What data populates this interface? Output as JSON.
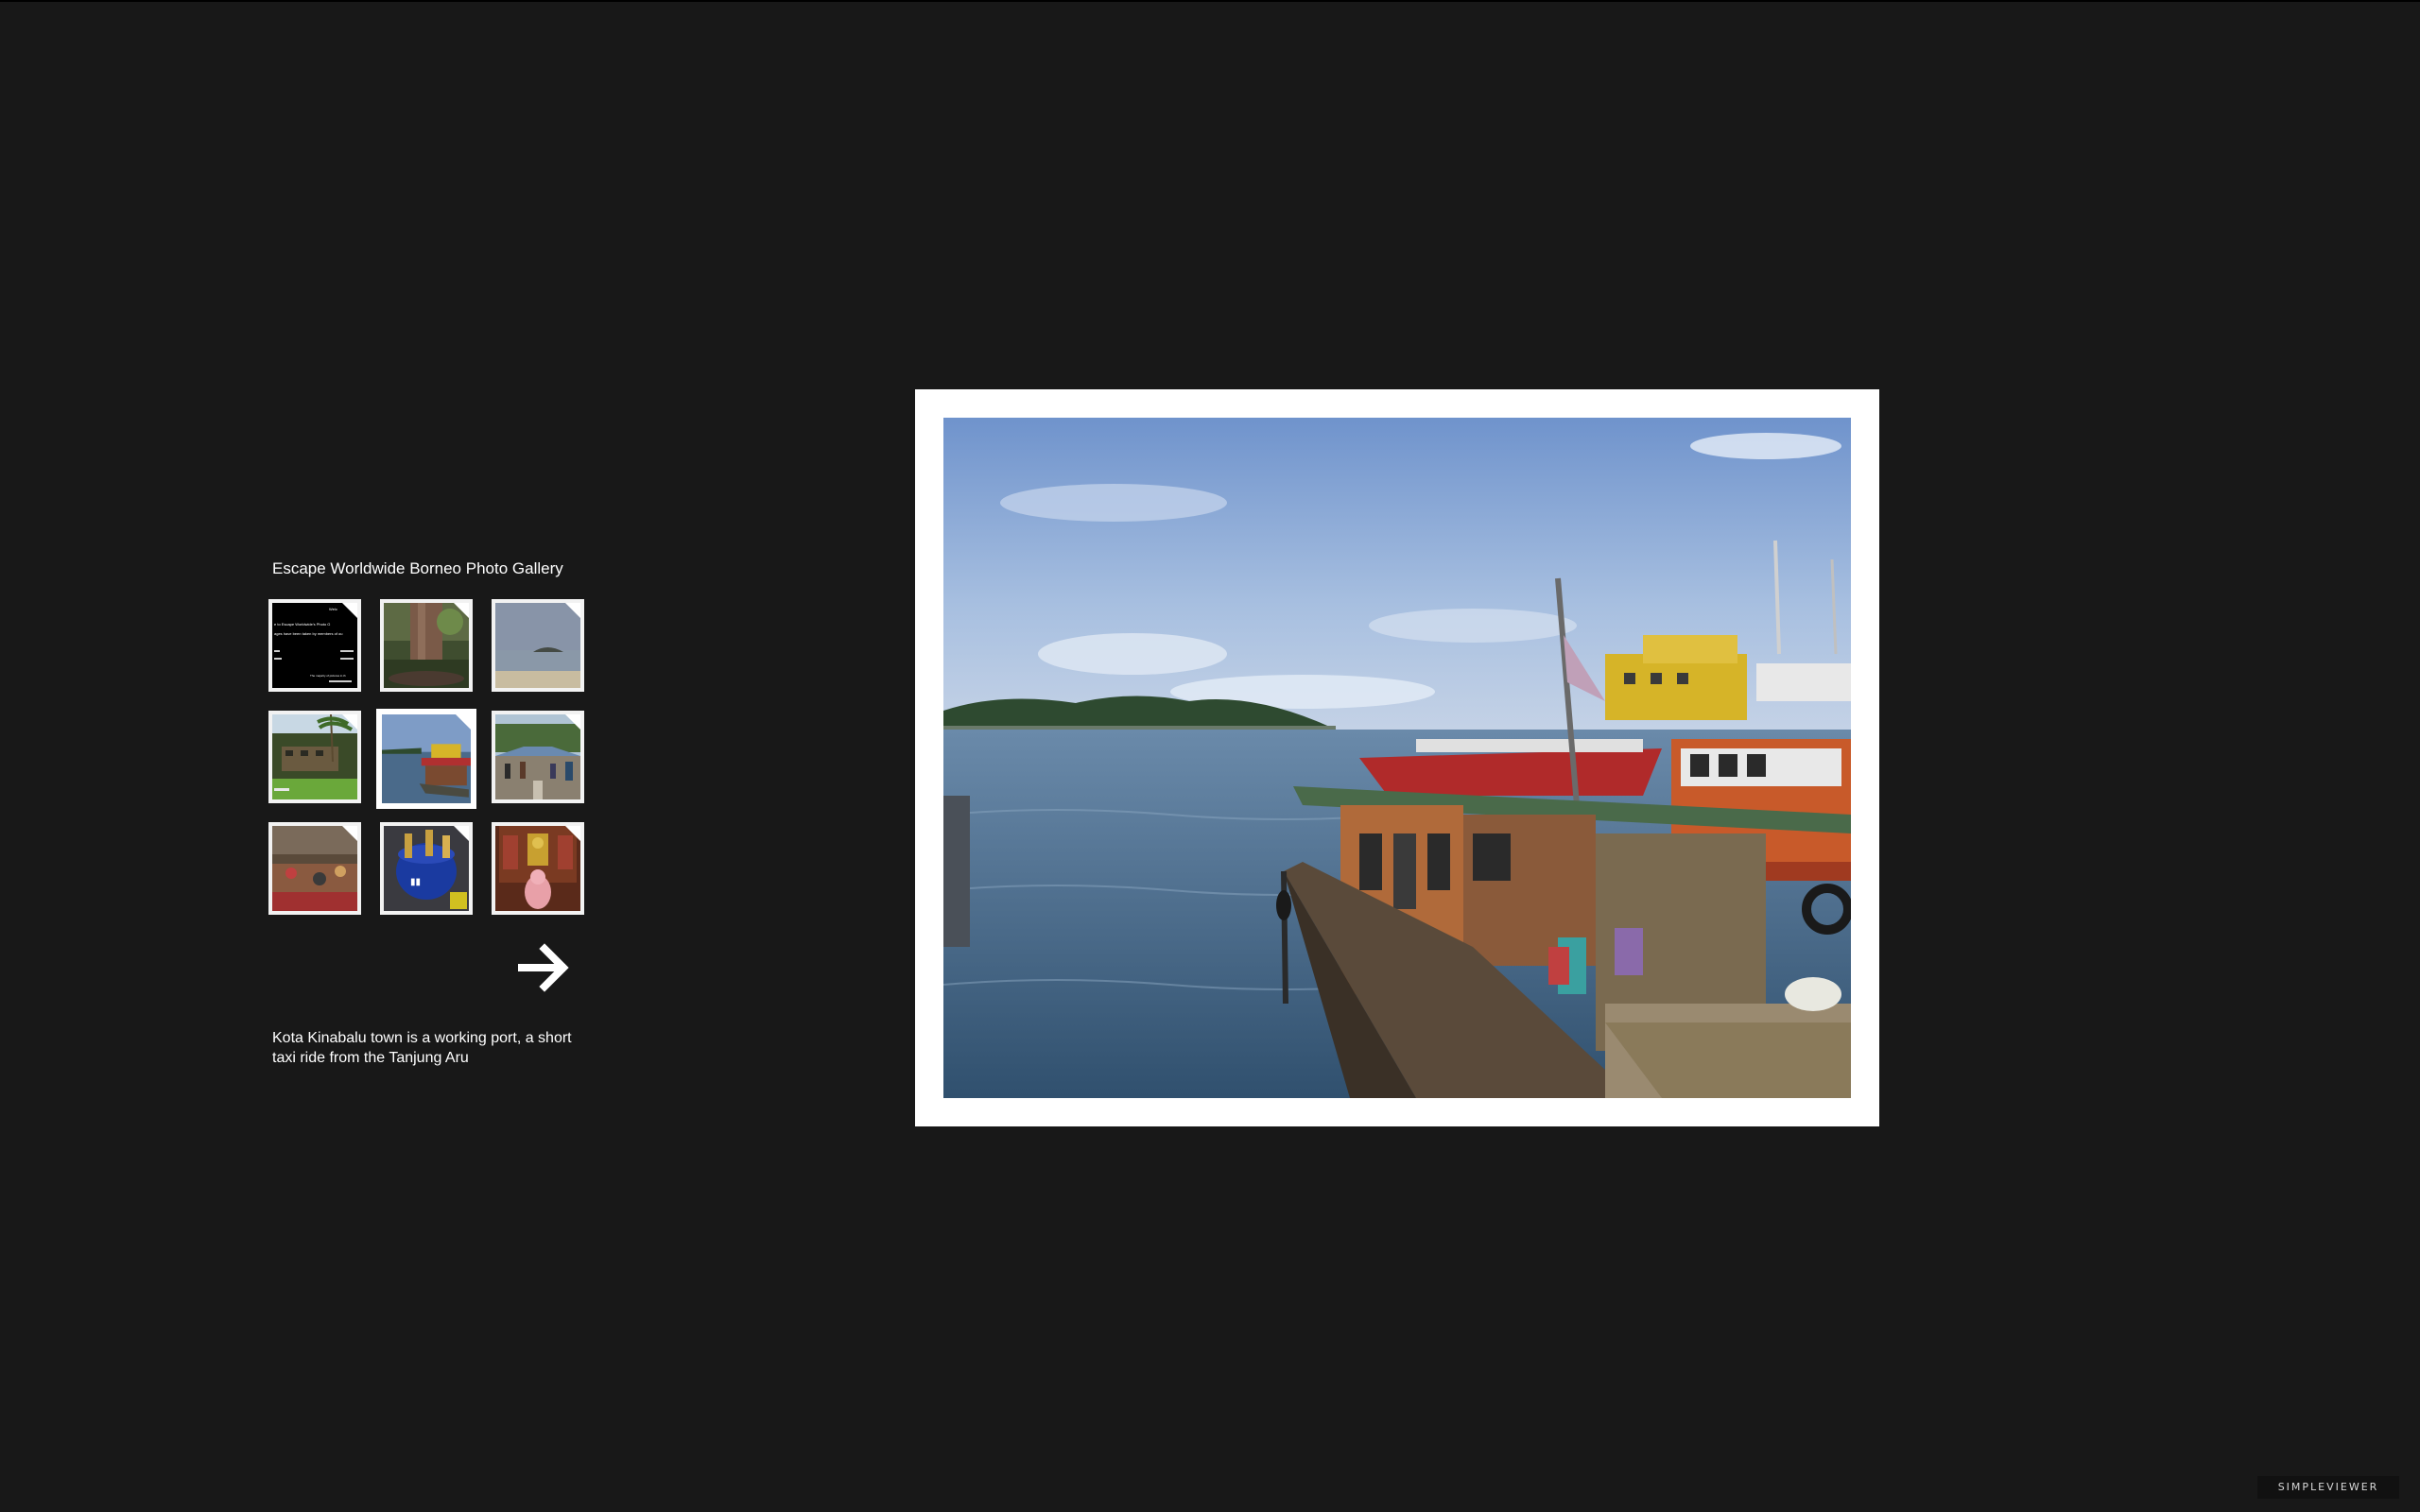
{
  "gallery": {
    "title": "Escape Worldwide Borneo Photo Gallery",
    "caption": "Kota Kinabalu town is a working port, a short taxi ride from the Tanjung Aru",
    "selected_index": 4,
    "thumbnails": [
      {
        "subject": "welcome-text-slide",
        "lines": [
          "Welc",
          "e to Escape Worldwide's Photo G",
          "ages have been taken by members of ou",
          "The majority of pictures in th"
        ]
      },
      {
        "subject": "rainforest-tree"
      },
      {
        "subject": "beach-island"
      },
      {
        "subject": "resort-palm"
      },
      {
        "subject": "harbor-boat"
      },
      {
        "subject": "market-street"
      },
      {
        "subject": "night-market"
      },
      {
        "subject": "drinks-bucket"
      },
      {
        "subject": "temple-statue"
      }
    ]
  },
  "navigation": {
    "next_icon": "arrow-right-icon"
  },
  "branding": {
    "label": "SIMPLEVIEWER"
  },
  "colors": {
    "background": "#181818",
    "frame": "#ffffff",
    "text": "#ffffff"
  }
}
